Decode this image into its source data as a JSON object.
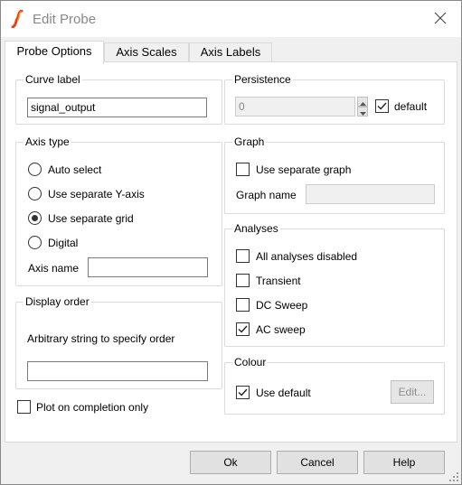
{
  "window": {
    "title": "Edit Probe",
    "icon": "simetrix-logo-icon",
    "close_icon": "close-icon"
  },
  "tabs": [
    {
      "label": "Probe Options",
      "active": true
    },
    {
      "label": "Axis Scales",
      "active": false
    },
    {
      "label": "Axis Labels",
      "active": false
    }
  ],
  "curve_label": {
    "title": "Curve label",
    "value": "signal_output"
  },
  "axis_type": {
    "title": "Axis type",
    "options": [
      {
        "label": "Auto select",
        "selected": false
      },
      {
        "label": "Use separate Y-axis",
        "selected": false
      },
      {
        "label": "Use separate grid",
        "selected": true
      },
      {
        "label": "Digital",
        "selected": false
      }
    ],
    "axis_name_label": "Axis name",
    "axis_name_value": ""
  },
  "display_order": {
    "title": "Display order",
    "description": "Arbitrary string to specify order",
    "value": ""
  },
  "plot_on_completion": {
    "label": "Plot on completion only",
    "checked": false
  },
  "persistence": {
    "title": "Persistence",
    "value": "0",
    "default_label": "default",
    "default_checked": true
  },
  "graph": {
    "title": "Graph",
    "use_separate_label": "Use separate graph",
    "use_separate_checked": false,
    "graph_name_label": "Graph name",
    "graph_name_value": ""
  },
  "analyses": {
    "title": "Analyses",
    "items": [
      {
        "label": "All analyses disabled",
        "checked": false
      },
      {
        "label": "Transient",
        "checked": false
      },
      {
        "label": "DC Sweep",
        "checked": false
      },
      {
        "label": "AC sweep",
        "checked": true
      }
    ]
  },
  "colour": {
    "title": "Colour",
    "use_default_label": "Use default",
    "use_default_checked": true,
    "edit_label": "Edit..."
  },
  "footer": {
    "ok_label": "Ok",
    "cancel_label": "Cancel",
    "help_label": "Help"
  }
}
